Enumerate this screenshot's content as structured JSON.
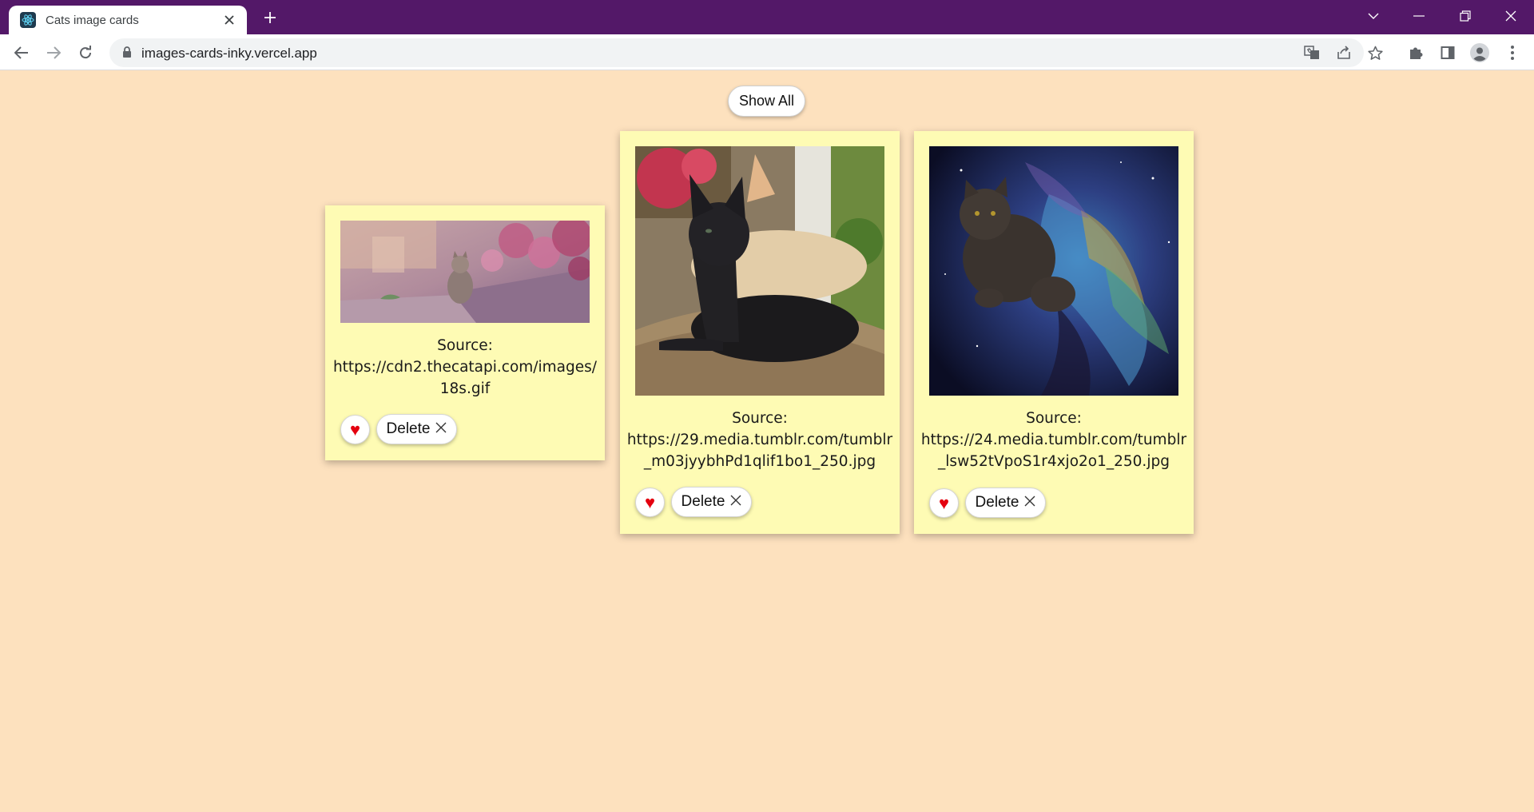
{
  "browser": {
    "tab_title": "Cats image cards",
    "url": "images-cards-inky.vercel.app",
    "frame_color": "#531868"
  },
  "page": {
    "background": "#fde1be",
    "show_all_label": "Show All"
  },
  "cards": [
    {
      "source_label": "Source:",
      "source_url": "https://cdn2.thecatapi.com/images/18s.gif",
      "heart_icon": "♥",
      "delete_label": "Delete"
    },
    {
      "source_label": "Source:",
      "source_url": "https://29.media.tumblr.com/tumblr_m03jyybhPd1qlif1bo1_250.jpg",
      "heart_icon": "♥",
      "delete_label": "Delete"
    },
    {
      "source_label": "Source:",
      "source_url": "https://24.media.tumblr.com/tumblr_lsw52tVpoS1r4xjo2o1_250.jpg",
      "heart_icon": "♥",
      "delete_label": "Delete"
    }
  ]
}
